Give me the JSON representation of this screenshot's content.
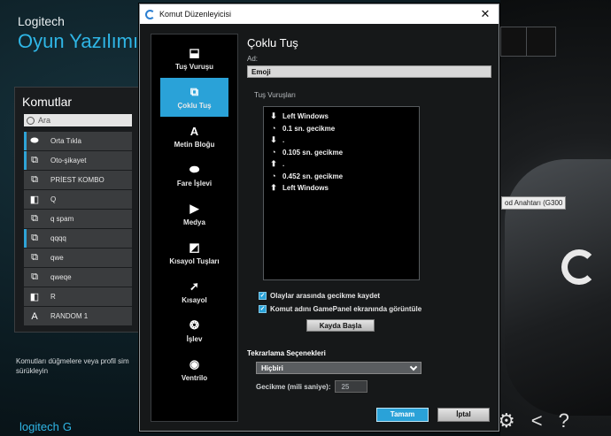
{
  "app": {
    "company": "Logitech",
    "product": "Oyun Yazılımı",
    "commands_title": "Komutlar",
    "search_placeholder": "Ara",
    "commands": [
      {
        "icon": "mouse-icon",
        "label": "Orta Tıkla",
        "flag": true
      },
      {
        "icon": "multikey-icon",
        "label": "Oto-şikayet",
        "flag": true
      },
      {
        "icon": "multikey-icon",
        "label": "PRİEST KOMBO",
        "flag": false
      },
      {
        "icon": "key-icon",
        "label": "Q",
        "flag": false
      },
      {
        "icon": "multikey-icon",
        "label": "q spam",
        "flag": false
      },
      {
        "icon": "multikey-icon",
        "label": "qqqq",
        "flag": true
      },
      {
        "icon": "multikey-icon",
        "label": "qwe",
        "flag": false
      },
      {
        "icon": "multikey-icon",
        "label": "qweqe",
        "flag": false
      },
      {
        "icon": "key-icon",
        "label": "R",
        "flag": false
      },
      {
        "icon": "text-block-icon",
        "label": "RANDOM 1",
        "flag": false
      }
    ],
    "hint": "Komutları düğmelere veya profil sim sürükleyin",
    "bottom_logo": "logitech",
    "assign_label": "od Anahtarı (G300"
  },
  "dialog": {
    "title": "Komut Düzenleyicisi",
    "sidebar": [
      {
        "icon": "keystroke-icon",
        "label": "Tuş Vuruşu",
        "active": false
      },
      {
        "icon": "multikey-icon",
        "label": "Çoklu Tuş",
        "active": true
      },
      {
        "icon": "text-block-icon",
        "label": "Metin Bloğu",
        "active": false
      },
      {
        "icon": "mouse-icon",
        "label": "Fare İşlevi",
        "active": false
      },
      {
        "icon": "media-play-icon",
        "label": "Medya",
        "active": false
      },
      {
        "icon": "hotkey-icon",
        "label": "Kısayol Tuşları",
        "active": false
      },
      {
        "icon": "shortcut-arrow-icon",
        "label": "Kısayol",
        "active": false
      },
      {
        "icon": "function-icon",
        "label": "İşlev",
        "active": false
      },
      {
        "icon": "ventrilo-icon",
        "label": "Ventrilo",
        "active": false
      }
    ],
    "heading": "Çoklu Tuş",
    "name_label": "Ad:",
    "name_value": "Emoji",
    "keystrokes_label": "Tuş Vuruşları",
    "keystrokes": [
      {
        "icon": "arrow-down-icon",
        "text": "Left Windows"
      },
      {
        "icon": "clock-icon",
        "text": "0.1 sn. gecikme"
      },
      {
        "icon": "arrow-down-icon",
        "text": "."
      },
      {
        "icon": "clock-icon",
        "text": "0.105 sn. gecikme"
      },
      {
        "icon": "arrow-up-icon",
        "text": "."
      },
      {
        "icon": "clock-icon",
        "text": "0.452 sn. gecikme"
      },
      {
        "icon": "arrow-up-icon",
        "text": "Left Windows"
      }
    ],
    "checkbox_record_delay": "Olaylar arasında gecikme kaydet",
    "checkbox_show_name": "Komut adını GamePanel ekranında görüntüle",
    "record_button": "Kayda Başla",
    "repeat_title": "Tekrarlama Seçenekleri",
    "repeat_value": "Hiçbiri",
    "delay_label": "Gecikme (mili saniye):",
    "delay_value": "25",
    "ok_button": "Tamam",
    "cancel_button": "İptal",
    "accent": "#2aa2d8"
  }
}
